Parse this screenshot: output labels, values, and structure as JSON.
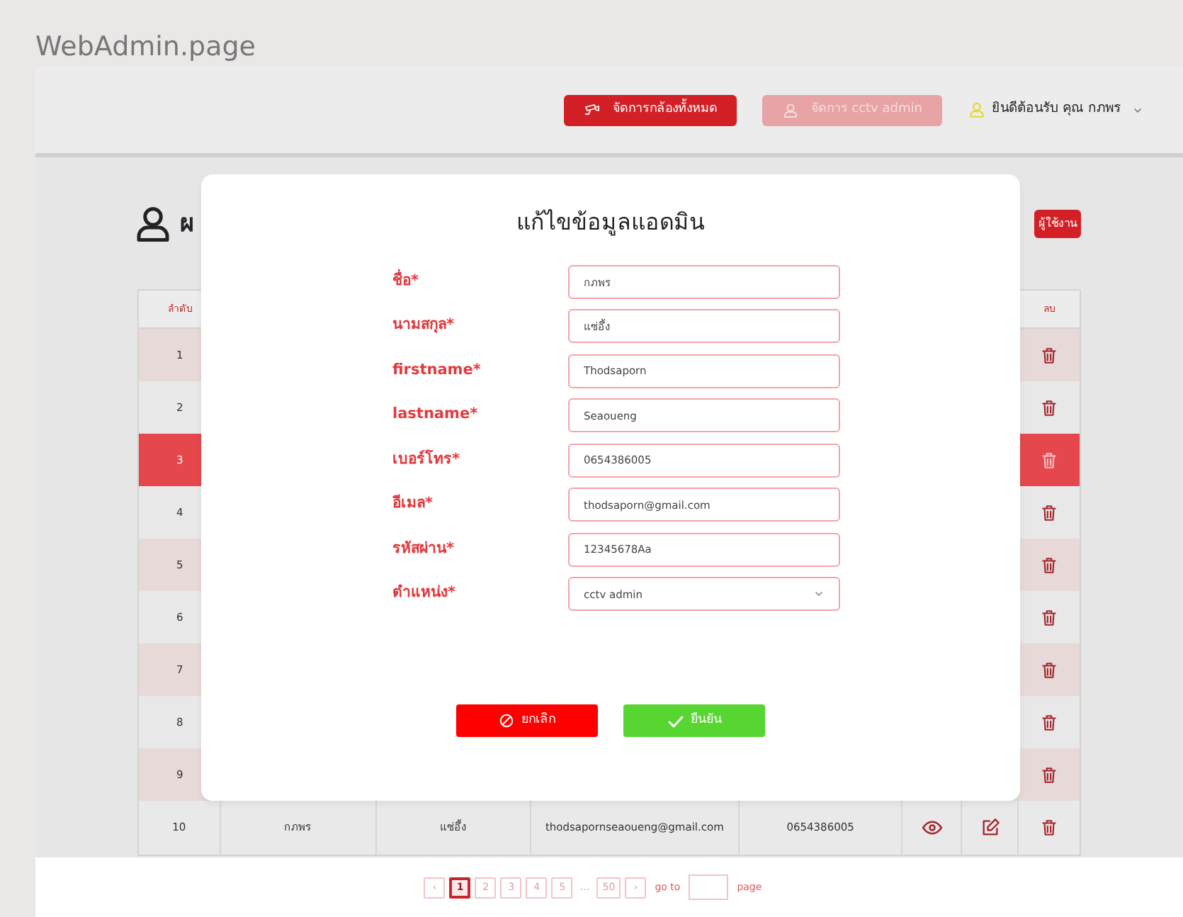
{
  "app_title": "WebAdmin.page",
  "header": {
    "buttons": [
      {
        "label": "จัดการกล้องทั้งหมด",
        "kind": "cameras",
        "selected": false
      },
      {
        "label": "จัดการ cctv admin",
        "kind": "admins",
        "selected": true
      }
    ],
    "greeting": "ยินดีต้อนรับ คุณ กภพร"
  },
  "page": {
    "title": "ผ",
    "add_button": "ผู้ใช้งาน"
  },
  "table": {
    "columns": [
      "ลำดับ",
      "ลบ"
    ],
    "rows": [
      {
        "number": "1",
        "selected": false
      },
      {
        "number": "2",
        "selected": false
      },
      {
        "number": "3",
        "selected": true
      },
      {
        "number": "4",
        "selected": false
      },
      {
        "number": "5",
        "selected": false
      },
      {
        "number": "6",
        "selected": false
      },
      {
        "number": "7",
        "selected": false
      },
      {
        "number": "8",
        "selected": false
      },
      {
        "number": "9",
        "selected": false
      },
      {
        "number": "10",
        "selected": false,
        "name": "กภพร",
        "surname": "แซ่อึ้ง",
        "email": "thodsapornseaoueng@gmail.com",
        "phone": "0654386005"
      }
    ]
  },
  "modal": {
    "title": "แก้ไขข้อมูลแอดมิน",
    "fields": [
      {
        "label": "ชื่อ*",
        "value": "กภพร",
        "kind": "text"
      },
      {
        "label": "นามสกุล*",
        "value": "แซ่อึ้ง",
        "kind": "text"
      },
      {
        "label": "firstname*",
        "value": "Thodsaporn",
        "kind": "text"
      },
      {
        "label": "lastname*",
        "value": "Seaoueng",
        "kind": "text"
      },
      {
        "label": "เบอร์โทร*",
        "value": "0654386005",
        "kind": "text"
      },
      {
        "label": "อีเมล*",
        "value": "thodsaporn@gmail.com",
        "kind": "text"
      },
      {
        "label": "รหัสผ่าน*",
        "value": "12345678Aa",
        "kind": "text"
      },
      {
        "label": "ตำแหน่ง*",
        "value": "cctv admin",
        "kind": "select"
      }
    ],
    "buttons": [
      {
        "label": "ยกเลิก",
        "kind": "cancel"
      },
      {
        "label": "ยืนยัน",
        "kind": "confirm"
      }
    ]
  },
  "pagination": {
    "prev": "‹",
    "next": "›",
    "pages": [
      {
        "label": "1",
        "kind": "page",
        "selected": true
      },
      {
        "label": "2",
        "kind": "page",
        "selected": false
      },
      {
        "label": "3",
        "kind": "page",
        "selected": false
      },
      {
        "label": "4",
        "kind": "page",
        "selected": false
      },
      {
        "label": "5",
        "kind": "page",
        "selected": false
      },
      {
        "label": "…",
        "kind": "ellipsis"
      },
      {
        "label": "50",
        "kind": "page",
        "selected": false
      }
    ],
    "goto_label": "go to",
    "page_label": "page"
  }
}
